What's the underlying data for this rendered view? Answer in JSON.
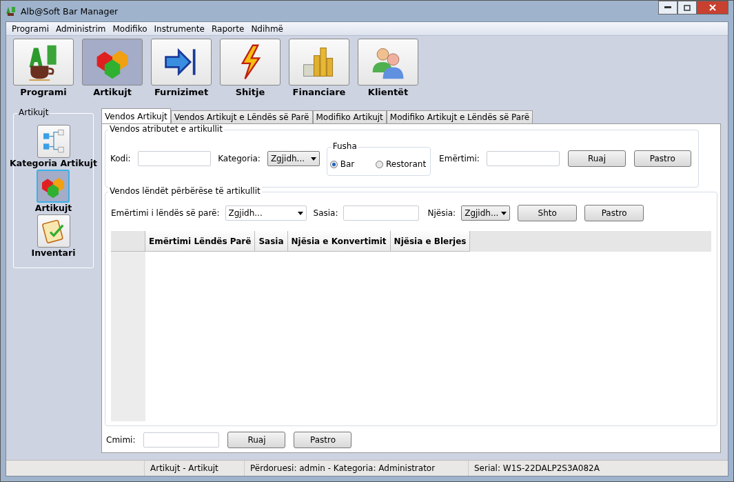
{
  "window": {
    "title": "Alb@Soft Bar Manager"
  },
  "menu": [
    "Programi",
    "Administrim",
    "Modifiko",
    "Instrumente",
    "Raporte",
    "Ndihmë"
  ],
  "toolbar": [
    {
      "label": "Programi",
      "selected": false
    },
    {
      "label": "Artikujt",
      "selected": true
    },
    {
      "label": "Furnizimet",
      "selected": false
    },
    {
      "label": "Shitje",
      "selected": false
    },
    {
      "label": "Financiare",
      "selected": false
    },
    {
      "label": "Klientët",
      "selected": false
    }
  ],
  "sidebar": {
    "title": "Artikujt",
    "items": [
      {
        "label": "Kategoria Artikujt",
        "selected": false
      },
      {
        "label": "Artikujt",
        "selected": true
      },
      {
        "label": "Inventari",
        "selected": false
      }
    ]
  },
  "tabs": [
    {
      "label": "Vendos Artikujt",
      "selected": true
    },
    {
      "label": "Vendos Artikujt e Lëndës së Parë",
      "selected": false
    },
    {
      "label": "Modifiko Artikujt",
      "selected": false
    },
    {
      "label": "Modifiko Artikujt e Lëndës së Parë",
      "selected": false
    }
  ],
  "attributes": {
    "title": "Vendos atributet e artikullit",
    "code_label": "Kodi:",
    "category_label": "Kategoria:",
    "category_value": "Zgjidh...",
    "fusha": {
      "title": "Fusha",
      "options": [
        {
          "label": "Bar",
          "selected": true
        },
        {
          "label": "Restorant",
          "selected": false
        }
      ]
    },
    "name_label": "Emërtimi:",
    "buttons": [
      "Ruaj",
      "Pastro"
    ]
  },
  "ingredients": {
    "title": "Vendos lëndët përbërëse të artikullit",
    "name_label": "Emërtimi i lëndës së parë:",
    "name_value": "Zgjidh...",
    "qty_label": "Sasia:",
    "unit_label": "Njësia:",
    "unit_value": "Zgjidh...",
    "buttons": [
      "Shto",
      "Pastro"
    ],
    "columns": [
      "Emërtimi Lëndës Parë",
      "Sasia",
      "Njësia e Konvertimit",
      "Njësia e Blerjes"
    ]
  },
  "price": {
    "label": "Cmimi:",
    "buttons": [
      "Ruaj",
      "Pastro"
    ]
  },
  "status_bar": [
    "Artikujt - Artikujt",
    "Përdoruesi: admin - Kategoria: Administrator",
    "Serial: W1S-22DALP2S3A082A"
  ]
}
